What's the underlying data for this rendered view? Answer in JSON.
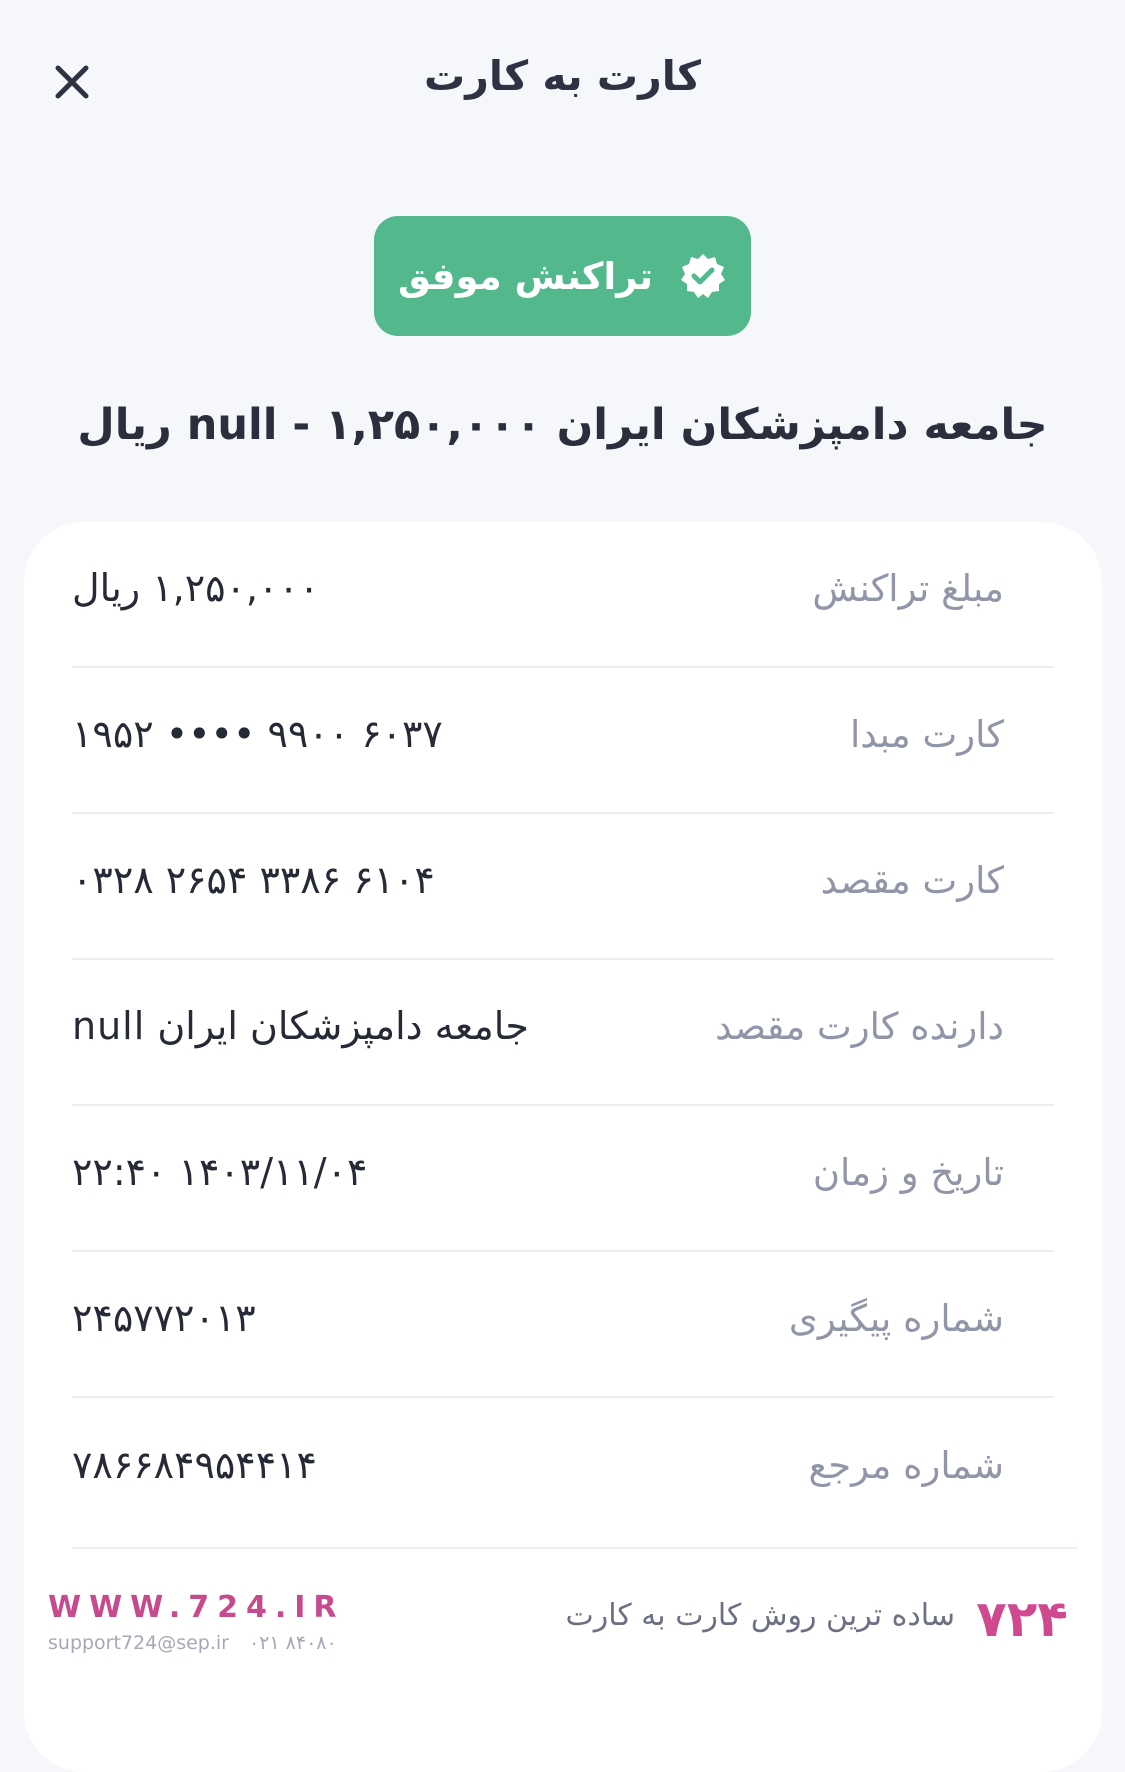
{
  "header": {
    "title": "کارت به کارت",
    "close_icon": "close-icon"
  },
  "status": {
    "label": "تراکنش موفق",
    "icon": "verified-badge-icon",
    "color": "#54b88d"
  },
  "headline": "جامعه دامپزشکان ایران null - ۱,۲۵۰,۰۰۰ ریال",
  "details": [
    {
      "label": "مبلغ تراکنش",
      "value": "۱,۲۵۰,۰۰۰ ریال"
    },
    {
      "label": "کارت مبدا",
      "value": "۶۰۳۷ ۹۹۰۰ •••• ۱۹۵۲"
    },
    {
      "label": "کارت مقصد",
      "value": "۶۱۰۴ ۳۳۸۶ ۲۶۵۴ ۰۳۲۸"
    },
    {
      "label": "دارنده کارت مقصد",
      "value": "جامعه دامپزشکان ایران null"
    },
    {
      "label": "تاریخ و زمان",
      "value": "۱۴۰۳/۱۱/۰۴ ۲۲:۴۰"
    },
    {
      "label": "شماره پیگیری",
      "value": "۲۴۵۷۷۲۰۱۳"
    },
    {
      "label": "شماره مرجع",
      "value": "۷۸۶۶۸۴۹۵۴۴۱۴"
    }
  ],
  "footer": {
    "site": "WWW.724.IR",
    "email": "support724@sep.ir",
    "phone": "۰۲۱ ۸۴۰۸۰",
    "tagline": "ساده ترین روش کارت به کارت",
    "logo": "۷۲۴",
    "brand_color": "#d0488f"
  }
}
